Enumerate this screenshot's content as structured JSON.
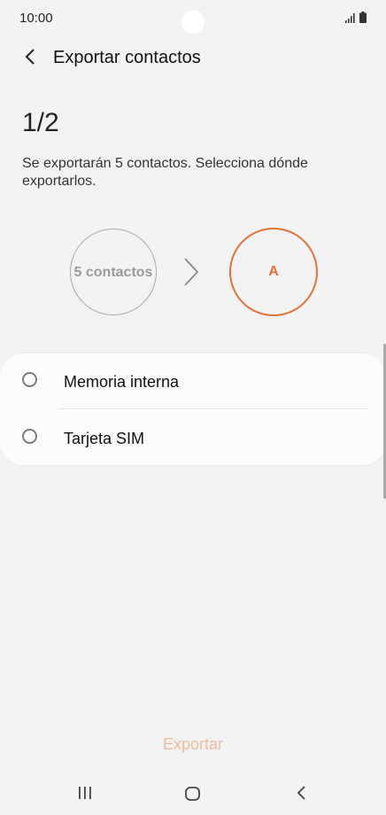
{
  "status_bar": {
    "time": "10:00"
  },
  "header": {
    "title": "Exportar contactos"
  },
  "step": "1/2",
  "description": "Se exportarán 5 contactos. Selecciona dónde exportarlos.",
  "flow": {
    "source_label": "5 contactos",
    "destination_label": "A"
  },
  "options": [
    {
      "label": "Memoria interna",
      "selected": false
    },
    {
      "label": "Tarjeta SIM",
      "selected": false
    }
  ],
  "action": {
    "export_label": "Exportar"
  },
  "colors": {
    "accent": "#e0733a",
    "accent_disabled": "#eebc9f",
    "background": "#f2f2f2"
  }
}
